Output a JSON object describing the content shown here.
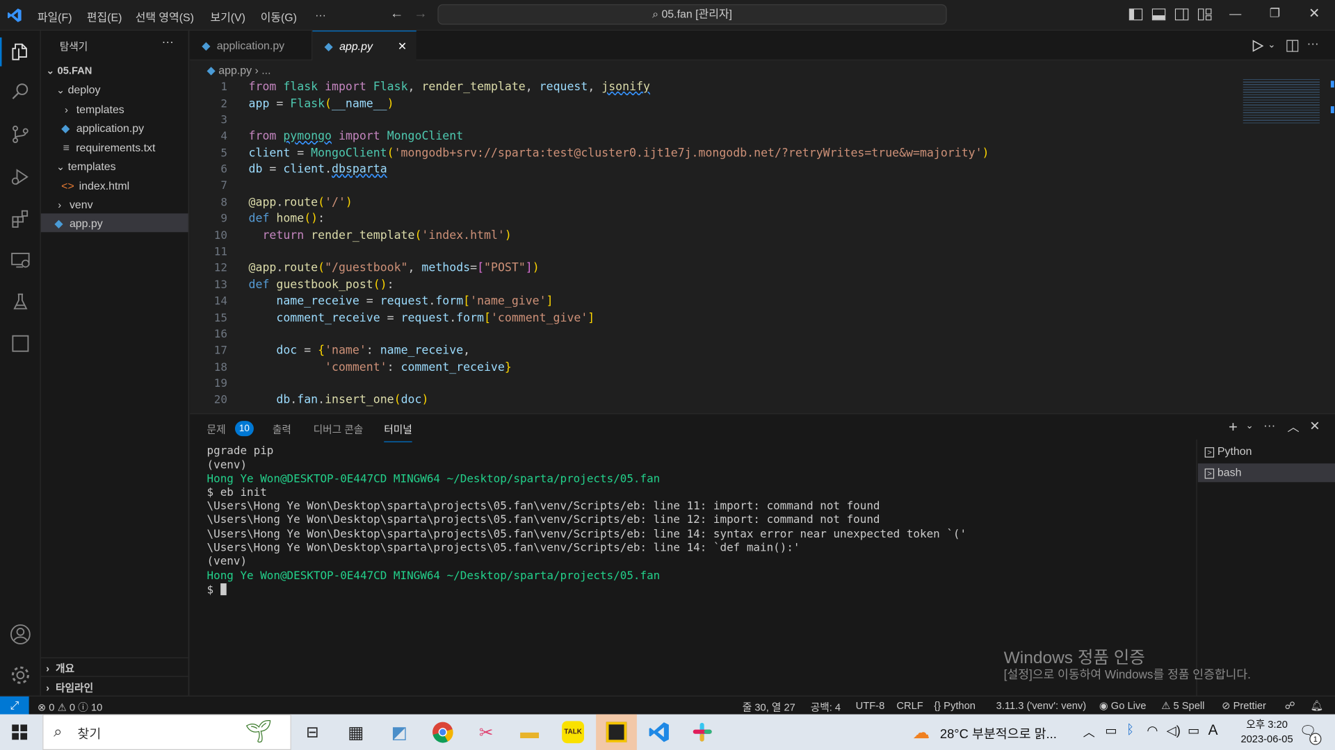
{
  "menu": [
    "파일(F)",
    "편집(E)",
    "선택 영역(S)",
    "보기(V)",
    "이동(G)",
    "···"
  ],
  "command_center": "05.fan [관리자]",
  "sidebar": {
    "title": "탐색기",
    "root": "05.FAN",
    "items": [
      {
        "label": "deploy"
      },
      {
        "label": "templates"
      },
      {
        "label": "application.py"
      },
      {
        "label": "requirements.txt"
      },
      {
        "label": "templates"
      },
      {
        "label": "index.html"
      },
      {
        "label": "venv"
      },
      {
        "label": "app.py"
      }
    ],
    "outline": "개요",
    "timeline": "타임라인"
  },
  "tabs": [
    {
      "label": "application.py"
    },
    {
      "label": "app.py"
    }
  ],
  "breadcrumb": {
    "file": "app.py",
    "rest": "..."
  },
  "line_numbers": [
    "1",
    "2",
    "3",
    "4",
    "5",
    "6",
    "7",
    "8",
    "9",
    "10",
    "11",
    "12",
    "13",
    "14",
    "15",
    "16",
    "17",
    "18",
    "19",
    "20"
  ],
  "panel": {
    "tabs": [
      "문제",
      "출력",
      "디버그 콘솔",
      "터미널"
    ],
    "problems_count": "10",
    "terminals": [
      "Python",
      "bash"
    ]
  },
  "terminal_lines": [
    "pgrade pip",
    "(venv)",
    "Hong Ye Won@DESKTOP-0E447CD MINGW64 ~/Desktop/sparta/projects/05.fan",
    "$ eb init",
    "\\Users\\Hong Ye Won\\Desktop\\sparta\\projects\\05.fan\\venv/Scripts/eb: line 11: import: command not found",
    "\\Users\\Hong Ye Won\\Desktop\\sparta\\projects\\05.fan\\venv/Scripts/eb: line 12: import: command not found",
    "\\Users\\Hong Ye Won\\Desktop\\sparta\\projects\\05.fan\\venv/Scripts/eb: line 14: syntax error near unexpected token `('",
    "\\Users\\Hong Ye Won\\Desktop\\sparta\\projects\\05.fan\\venv/Scripts/eb: line 14: `def main():'",
    "(venv)",
    "Hong Ye Won@DESKTOP-0E447CD MINGW64 ~/Desktop/sparta/projects/05.fan",
    "$ "
  ],
  "watermark": {
    "line1": "Windows 정품 인증",
    "line2": "[설정]으로 이동하여 Windows를 정품 인증합니다."
  },
  "status": {
    "errors": "0",
    "warnings": "0",
    "info": "10",
    "position": "줄 30, 열 27",
    "spaces": "공백: 4",
    "encoding": "UTF-8",
    "eol": "CRLF",
    "language": "Python",
    "interpreter": "3.11.3 ('venv': venv)",
    "golive": "Go Live",
    "spell": "5 Spell",
    "prettier": "Prettier"
  },
  "taskbar": {
    "search": "찾기",
    "weather": "28°C  부분적으로 맑...",
    "time": "오후 3:20",
    "date": "2023-06-05",
    "notif": "1"
  }
}
